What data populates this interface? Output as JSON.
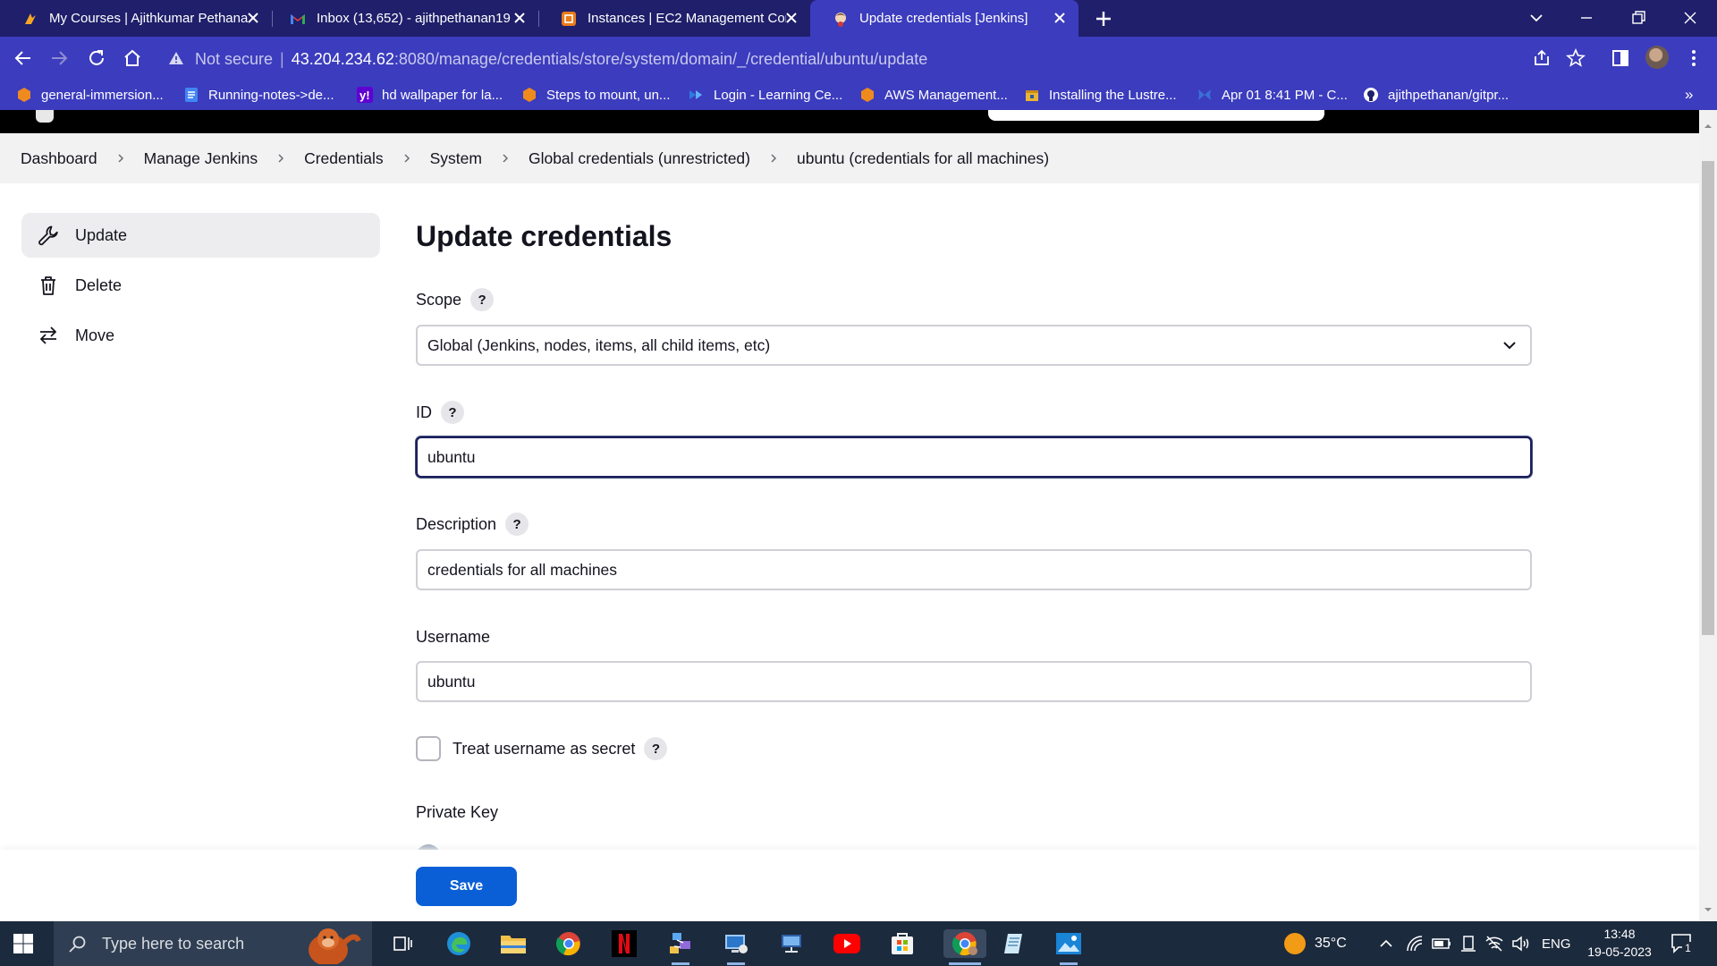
{
  "browser": {
    "tabs": [
      {
        "title": "My Courses | Ajithkumar Pethana",
        "icon": "course-site-icon"
      },
      {
        "title": "Inbox (13,652) - ajithpethanan19",
        "icon": "gmail-icon"
      },
      {
        "title": "Instances | EC2 Management Cor",
        "icon": "aws-ec2-icon"
      },
      {
        "title": "Update credentials [Jenkins]",
        "icon": "jenkins-icon"
      }
    ],
    "security_label": "Not secure",
    "url_host": "43.204.234.62",
    "url_path": ":8080/manage/credentials/store/system/domain/_/credential/ubuntu/update",
    "bookmarks": [
      {
        "label": "general-immersion...",
        "icon": "aws-cube-icon"
      },
      {
        "label": "Running-notes->de...",
        "icon": "google-docs-icon"
      },
      {
        "label": "hd wallpaper for la...",
        "icon": "yahoo-icon"
      },
      {
        "label": "Steps to mount, un...",
        "icon": "aws-cube-icon"
      },
      {
        "label": "Login - Learning Ce...",
        "icon": "learning-center-icon"
      },
      {
        "label": "AWS Management...",
        "icon": "aws-cube-icon"
      },
      {
        "label": "Installing the Lustre...",
        "icon": "package-icon"
      },
      {
        "label": "Apr 01 8:41 PM - C...",
        "icon": "butterfly-icon"
      },
      {
        "label": "ajithpethanan/gitpr...",
        "icon": "github-icon"
      }
    ],
    "more_bookmarks": "»"
  },
  "breadcrumb": [
    "Dashboard",
    "Manage Jenkins",
    "Credentials",
    "System",
    "Global credentials (unrestricted)",
    "ubuntu (credentials for all machines)"
  ],
  "sidebar": {
    "items": [
      {
        "label": "Update",
        "icon": "wrench-icon"
      },
      {
        "label": "Delete",
        "icon": "trash-icon"
      },
      {
        "label": "Move",
        "icon": "arrows-swap-icon"
      }
    ]
  },
  "form": {
    "title": "Update credentials",
    "scope_label": "Scope",
    "scope_value": "Global (Jenkins, nodes, items, all child items, etc)",
    "id_label": "ID",
    "id_value": "ubuntu",
    "description_label": "Description",
    "description_value": "credentials for all machines",
    "username_label": "Username",
    "username_value": "ubuntu",
    "treat_secret_label": "Treat username as secret",
    "treat_secret_checked": false,
    "private_key_label": "Private Key",
    "help_glyph": "?",
    "save_label": "Save"
  },
  "taskbar": {
    "search_placeholder": "Type here to search",
    "weather": "35°C",
    "language": "ENG",
    "time": "13:48",
    "date": "19-05-2023",
    "notification_count": "1"
  },
  "colors": {
    "browser_frame": "#1f1f6b",
    "toolbar": "#3c3cbe",
    "save_button": "#0b5fd6",
    "focused_border": "#1d1d5e"
  }
}
